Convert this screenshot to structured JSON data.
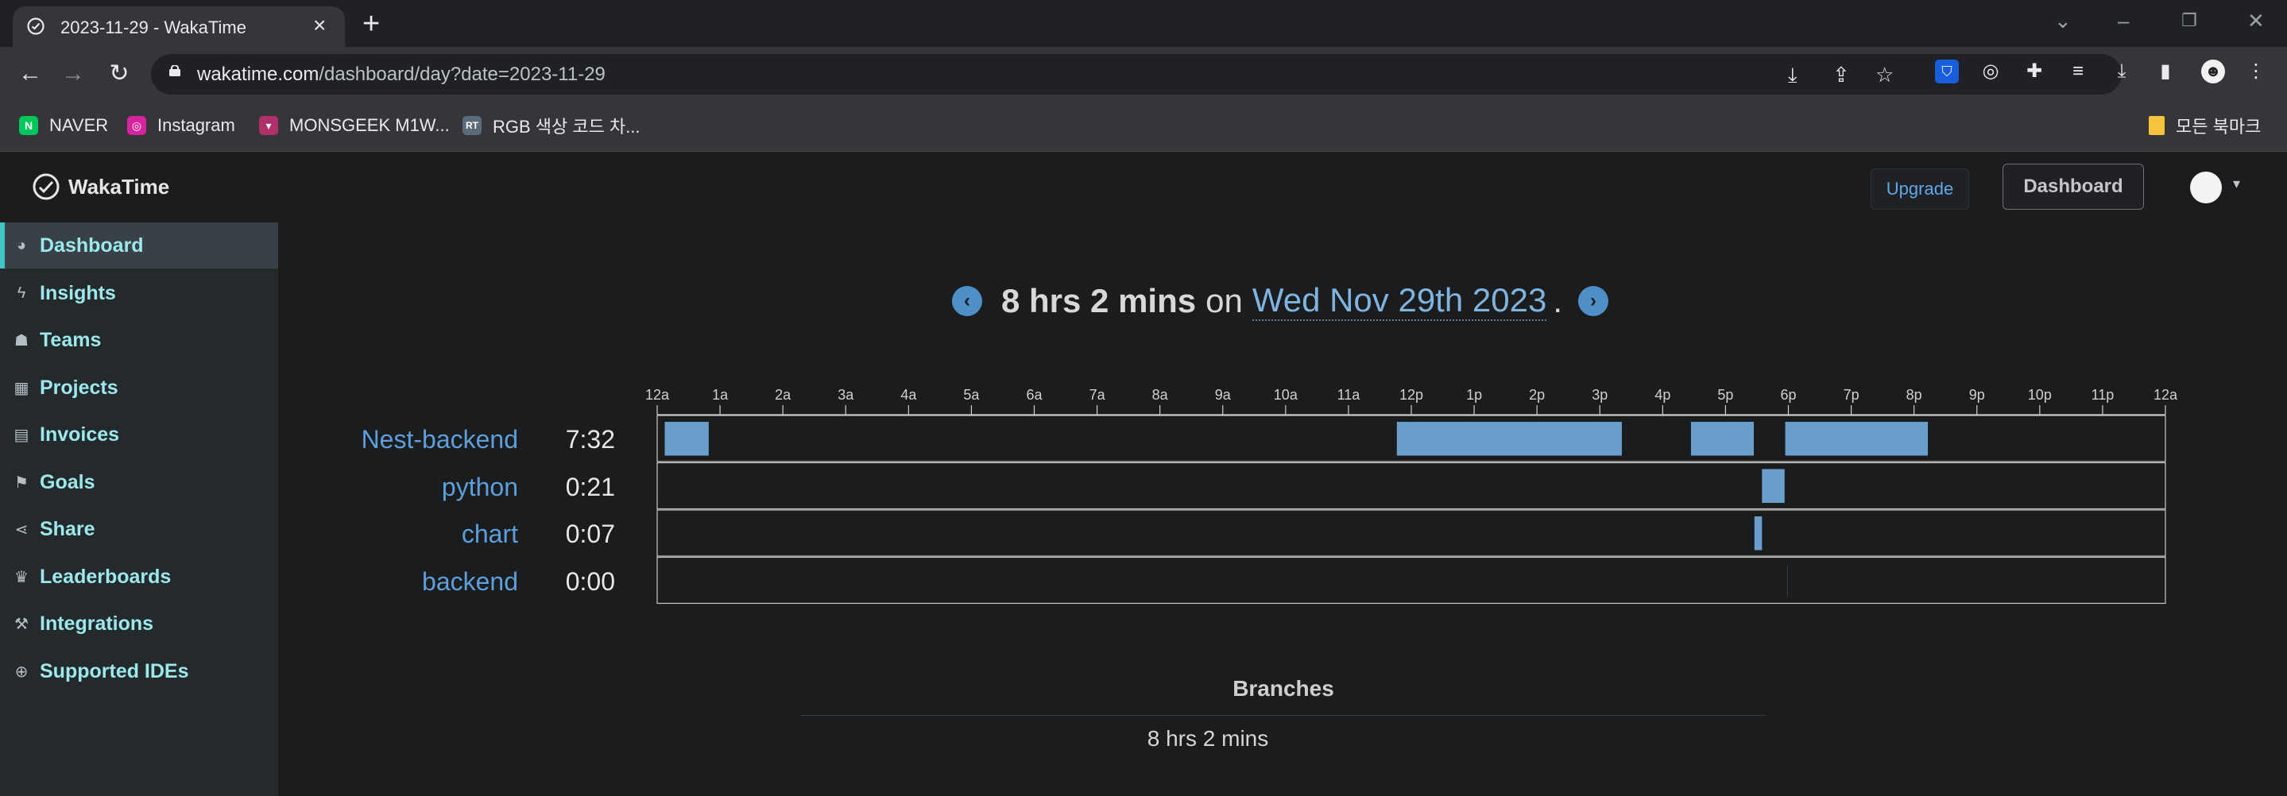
{
  "browser": {
    "tab_title": "2023-11-29 - WakaTime",
    "url_host": "wakatime.com",
    "url_path": "/dashboard/day?date=2023-11-29",
    "bookmarks": [
      {
        "label": "NAVER",
        "icon": "naver-icon",
        "color": "#03c75a"
      },
      {
        "label": "Instagram",
        "icon": "instagram-icon",
        "color": "#d6249f"
      },
      {
        "label": "MONSGEEK M1W...",
        "icon": "monsgeek-icon",
        "color": "#b0306a"
      },
      {
        "label": "RGB 색상 코드 차...",
        "icon": "rgb-icon",
        "color": "#5a6b7a"
      }
    ],
    "other_bookmarks": "모든 북마크"
  },
  "header": {
    "logo_text": "WakaTime",
    "upgrade_label": "Upgrade",
    "dashboard_label": "Dashboard"
  },
  "sidebar": {
    "items": [
      {
        "label": "Dashboard",
        "icon": "dashboard-icon",
        "active": true
      },
      {
        "label": "Insights",
        "icon": "bolt-icon",
        "active": false
      },
      {
        "label": "Teams",
        "icon": "users-icon",
        "active": false
      },
      {
        "label": "Projects",
        "icon": "grid-icon",
        "active": false
      },
      {
        "label": "Invoices",
        "icon": "document-icon",
        "active": false
      },
      {
        "label": "Goals",
        "icon": "flag-icon",
        "active": false
      },
      {
        "label": "Share",
        "icon": "share-icon",
        "active": false
      },
      {
        "label": "Leaderboards",
        "icon": "trophy-icon",
        "active": false
      },
      {
        "label": "Integrations",
        "icon": "wrench-icon",
        "active": false
      },
      {
        "label": "Supported IDEs",
        "icon": "plus-circle-icon",
        "active": false
      }
    ]
  },
  "summary": {
    "total": "8 hrs 2 mins",
    "on": "on",
    "date": "Wed Nov 29th 2023",
    "dot": "."
  },
  "chart_data": {
    "type": "timeline",
    "x_ticks": [
      "12a",
      "1a",
      "2a",
      "3a",
      "4a",
      "5a",
      "6a",
      "7a",
      "8a",
      "9a",
      "10a",
      "11a",
      "12p",
      "1p",
      "2p",
      "3p",
      "4p",
      "5p",
      "6p",
      "7p",
      "8p",
      "9p",
      "10p",
      "11p",
      "12a"
    ],
    "x_range_hours": [
      0,
      24
    ],
    "rows": [
      {
        "project": "Nest-backend",
        "time": "7:32",
        "segments": [
          [
            0.12,
            0.82
          ],
          [
            11.77,
            15.35
          ],
          [
            16.45,
            17.45
          ],
          [
            17.95,
            20.22
          ]
        ]
      },
      {
        "project": "python",
        "time": "0:21",
        "segments": [
          [
            17.58,
            17.94
          ]
        ]
      },
      {
        "project": "chart",
        "time": "0:07",
        "segments": [
          [
            17.46,
            17.58
          ]
        ]
      },
      {
        "project": "backend",
        "time": "0:00",
        "segments": [
          [
            17.98,
            17.99
          ]
        ]
      }
    ],
    "bar_color": "#6b9fcb"
  },
  "branches": {
    "title": "Branches",
    "total": "8 hrs 2 mins"
  }
}
